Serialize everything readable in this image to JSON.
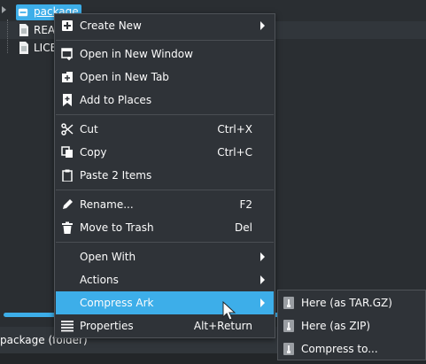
{
  "tree": {
    "rows": [
      {
        "name": "package",
        "type": "folder",
        "selected": true
      },
      {
        "name": "REA",
        "type": "file"
      },
      {
        "name": "LICE",
        "type": "file"
      }
    ]
  },
  "status_bar": {
    "text": "package (folder)"
  },
  "context_menu": {
    "items": [
      {
        "label": "Create New",
        "icon": "plus-square-icon",
        "submenu": true
      },
      {
        "label": "Open in New Window",
        "icon": "new-window-icon"
      },
      {
        "label": "Open in New Tab",
        "icon": "new-tab-icon"
      },
      {
        "label": "Add to Places",
        "icon": "bookmark-icon"
      },
      {
        "label": "Cut",
        "icon": "scissors-icon",
        "shortcut": "Ctrl+X"
      },
      {
        "label": "Copy",
        "icon": "copy-icon",
        "shortcut": "Ctrl+C"
      },
      {
        "label": "Paste 2 Items",
        "icon": "clipboard-icon"
      },
      {
        "label": "Rename...",
        "icon": "pencil-icon",
        "shortcut": "F2"
      },
      {
        "label": "Move to Trash",
        "icon": "trash-icon",
        "shortcut": "Del"
      },
      {
        "label": "Open With",
        "submenu": true
      },
      {
        "label": "Actions",
        "submenu": true
      },
      {
        "label": "Compress Ark",
        "submenu": true,
        "highlighted": true
      },
      {
        "label": "Properties",
        "icon": "list-icon",
        "shortcut": "Alt+Return"
      }
    ]
  },
  "compress_submenu": {
    "items": [
      {
        "label": "Here (as TAR.GZ)",
        "icon": "archive-icon"
      },
      {
        "label": "Here (as ZIP)",
        "icon": "archive-icon"
      },
      {
        "label": "Compress to...",
        "icon": "archive-icon"
      }
    ]
  },
  "colors": {
    "accent": "#3daee9",
    "menu_bg": "#2f3338",
    "window_bg": "#2a2e32"
  }
}
